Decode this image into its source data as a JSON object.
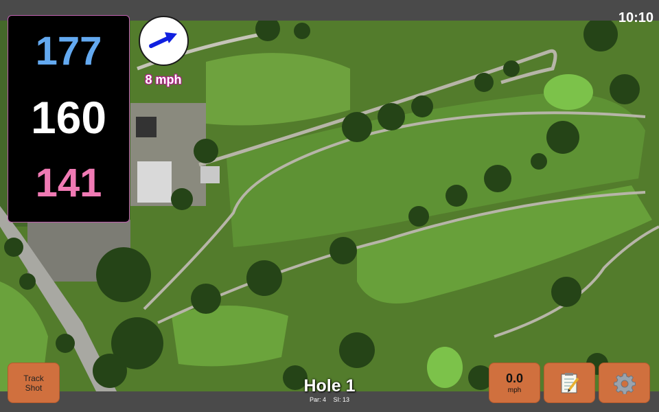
{
  "status": {
    "time": "10:10"
  },
  "distances": {
    "back": "177",
    "middle": "160",
    "front": "141"
  },
  "wind": {
    "speed_text": "8 mph",
    "icon": "wind-arrow-icon"
  },
  "hole": {
    "title": "Hole 1",
    "par": "Par: 4",
    "stroke_index": "SI: 13"
  },
  "buttons": {
    "track_shot_line1": "Track",
    "track_shot_line2": "Shot",
    "speed_value": "0.0",
    "speed_unit": "mph",
    "notes_icon": "notepad-icon",
    "settings_icon": "gear-icon"
  },
  "colors": {
    "back": "#63a9f0",
    "middle": "#ffffff",
    "front": "#f07ab4",
    "button": "#d0703e"
  }
}
